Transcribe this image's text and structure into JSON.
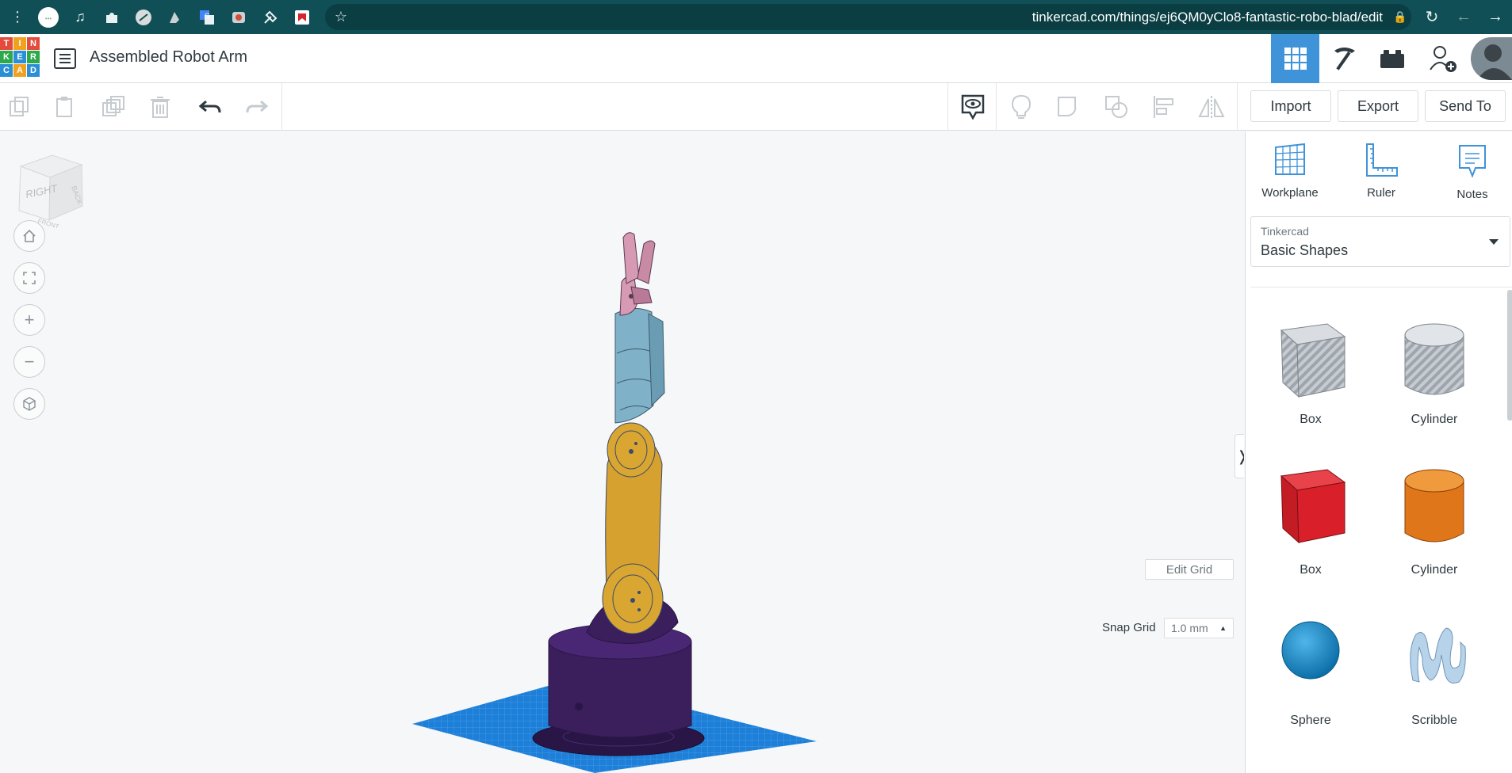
{
  "browser": {
    "url": "tinkercad.com/things/ej6QM0yClo8-fantastic-robo-blad/edit",
    "icons": [
      "menu-dots-icon",
      "profile-icon",
      "media-icon",
      "extensions-icon",
      "ext-icon-1",
      "ext-icon-2",
      "translate-icon",
      "ext-icon-3",
      "ext-icon-4",
      "ext-icon-5",
      "star-icon",
      "lock-icon",
      "reload-icon",
      "back-icon",
      "forward-icon"
    ]
  },
  "app": {
    "logo_letters": [
      "T",
      "I",
      "N",
      "K",
      "E",
      "R",
      "C",
      "A",
      "D"
    ],
    "title": "Assembled Robot Arm"
  },
  "toolbar": {
    "import_label": "Import",
    "export_label": "Export",
    "sendto_label": "Send To"
  },
  "viewcube": {
    "right": "RIGHT",
    "back": "BACK",
    "front": "FRONT"
  },
  "workplane": {
    "edit_grid_label": "Edit Grid",
    "snap_grid_label": "Snap Grid",
    "snap_grid_value": "1.0 mm"
  },
  "panel": {
    "workplane_label": "Workplane",
    "ruler_label": "Ruler",
    "notes_label": "Notes",
    "library_provider": "Tinkercad",
    "library_name": "Basic Shapes",
    "shapes": [
      {
        "label": "Box"
      },
      {
        "label": "Cylinder"
      },
      {
        "label": "Box"
      },
      {
        "label": "Cylinder"
      },
      {
        "label": "Sphere"
      },
      {
        "label": "Scribble"
      }
    ]
  },
  "colors": {
    "browser_bar": "#0f4f55",
    "accent": "#3f93d9",
    "arm_purple": "#3b1e5c",
    "arm_yellow": "#d6a12e",
    "arm_blue": "#7fb1c8",
    "arm_pink": "#d79ab4",
    "box_red": "#d9202a",
    "cylinder_orange": "#e0761a",
    "sphere_blue": "#1b8fd0"
  }
}
